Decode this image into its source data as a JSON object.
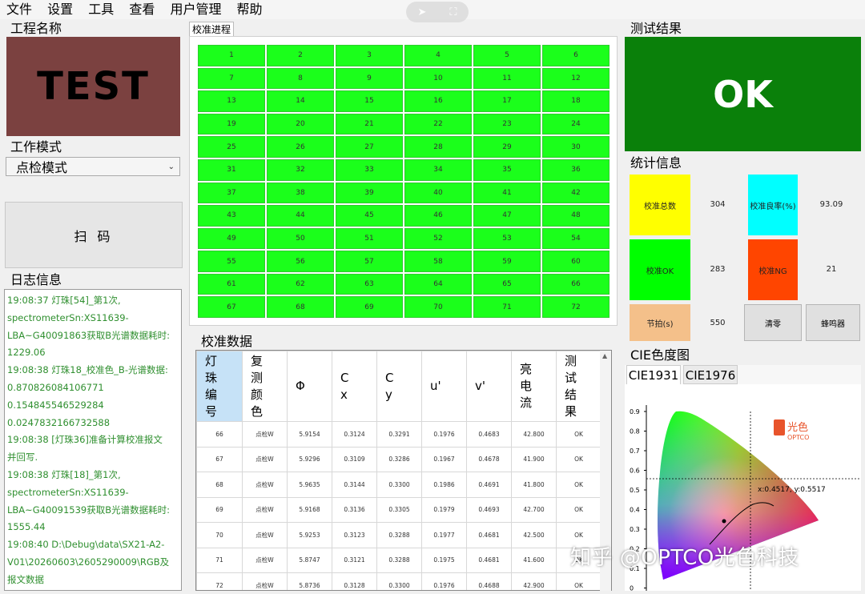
{
  "menu": [
    "文件",
    "设置",
    "工具",
    "查看",
    "用户管理",
    "帮助"
  ],
  "project": {
    "label": "工程名称",
    "name": "TEST"
  },
  "work_mode": {
    "label": "工作模式",
    "selected": "点检模式"
  },
  "scan_button": "扫 码",
  "log": {
    "label": "日志信息",
    "lines": [
      "19:08:37  灯珠[54]_第1次,",
      "spectrometerSn:XS11639-",
      "LBA~G40091863获取B光谱数据耗时:",
      "1229.06",
      "19:08:38  灯珠18_校准色_B-光谱数据:",
      "          0.870826084106771",
      "          0.154845546529284",
      "          0.0247832166732588",
      "19:08:38  [灯珠36]准备计算校准报文",
      "并回写.",
      "19:08:38  灯珠[18]_第1次,",
      "spectrometerSn:XS11639-",
      "LBA~G40091539获取B光谱数据耗时:",
      "1555.44",
      "19:08:40  D:\\Debug\\data\\SX21-A2-",
      "V01\\20260603\\2605290009\\RGB及",
      "报文数据"
    ]
  },
  "progress": {
    "tab": "校准进程",
    "cells": [
      "1",
      "2",
      "3",
      "4",
      "5",
      "6",
      "7",
      "8",
      "9",
      "10",
      "11",
      "12",
      "13",
      "14",
      "15",
      "16",
      "17",
      "18",
      "19",
      "20",
      "21",
      "22",
      "23",
      "24",
      "25",
      "26",
      "27",
      "28",
      "29",
      "30",
      "31",
      "32",
      "33",
      "34",
      "35",
      "36",
      "37",
      "38",
      "39",
      "40",
      "41",
      "42",
      "43",
      "44",
      "45",
      "46",
      "47",
      "48",
      "49",
      "50",
      "51",
      "52",
      "53",
      "54",
      "55",
      "56",
      "57",
      "58",
      "59",
      "60",
      "61",
      "62",
      "63",
      "64",
      "65",
      "66",
      "67",
      "68",
      "69",
      "70",
      "71",
      "72"
    ],
    "cell_color": "#1bff1b"
  },
  "data_table": {
    "label": "校准数据",
    "headers": [
      "灯珠编号",
      "复测颜色",
      "Φ",
      "Cx",
      "Cy",
      "u'",
      "v'",
      "亮电流",
      "测试结果"
    ],
    "rows": [
      [
        "66",
        "点检W",
        "5.9154",
        "0.3124",
        "0.3291",
        "0.1976",
        "0.4683",
        "42.800",
        "OK"
      ],
      [
        "67",
        "点检W",
        "5.9296",
        "0.3109",
        "0.3286",
        "0.1967",
        "0.4678",
        "41.900",
        "OK"
      ],
      [
        "68",
        "点检W",
        "5.9635",
        "0.3144",
        "0.3300",
        "0.1986",
        "0.4691",
        "41.800",
        "OK"
      ],
      [
        "69",
        "点检W",
        "5.9168",
        "0.3136",
        "0.3305",
        "0.1979",
        "0.4693",
        "42.700",
        "OK"
      ],
      [
        "70",
        "点检W",
        "5.9253",
        "0.3123",
        "0.3288",
        "0.1977",
        "0.4681",
        "42.500",
        "OK"
      ],
      [
        "71",
        "点检W",
        "5.8747",
        "0.3121",
        "0.3288",
        "0.1975",
        "0.4681",
        "41.600",
        "OK"
      ],
      [
        "72",
        "点检W",
        "5.8736",
        "0.3128",
        "0.3300",
        "0.1976",
        "0.4688",
        "42.900",
        "OK"
      ]
    ]
  },
  "result": {
    "label": "测试结果",
    "value": "OK",
    "color": "#0a800a"
  },
  "stats": {
    "label": "统计信息",
    "total": {
      "label": "校准总数",
      "value": "304",
      "color": "#ffff00"
    },
    "yield": {
      "label": "校准良率(%)",
      "value": "93.09",
      "color": "#00ffff"
    },
    "ok": {
      "label": "校准OK",
      "value": "283",
      "color": "#00ff00"
    },
    "ng": {
      "label": "校准NG",
      "value": "21",
      "color": "#ff4500"
    },
    "cycle": {
      "label": "节拍(s)",
      "value": "550",
      "color": "#f4c08a"
    },
    "clear_button": "清零",
    "buzzer_button": "蜂鸣器"
  },
  "cie": {
    "label": "CIE色度图",
    "tabs": [
      "CIE1931",
      "CIE1976"
    ],
    "active_tab": "CIE1931",
    "y_ticks": [
      "0.9",
      "0.8",
      "0.7",
      "0.6",
      "0.5",
      "0.4",
      "0.3",
      "0.2",
      "0.1",
      "0"
    ],
    "point_label": "x:0.4517, y:0.5517",
    "logo_cn": "光色",
    "logo_en": "OPTCO"
  },
  "watermark": "知乎 @OPTCO光色科技"
}
